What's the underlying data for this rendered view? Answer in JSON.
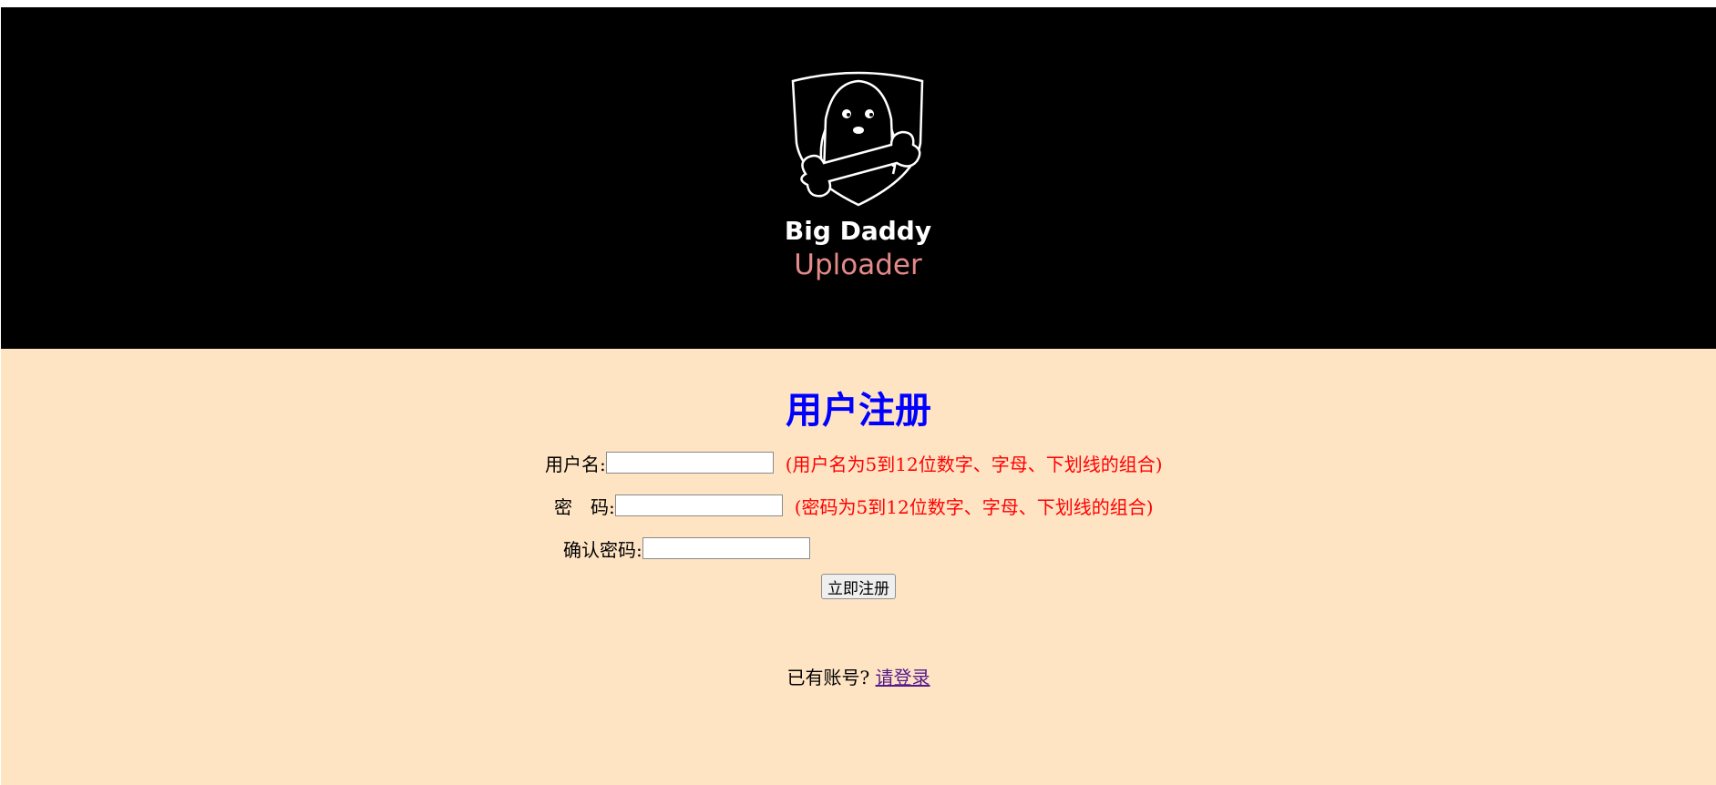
{
  "logo": {
    "line1": "Big Daddy",
    "line2": "Uploader",
    "icon": "dog-with-bone-shield-icon"
  },
  "form": {
    "title": "用户注册",
    "username": {
      "label": "用户名:",
      "value": "",
      "hint": "(用户名为5到12位数字、字母、下划线的组合)"
    },
    "password": {
      "label": "密　码:",
      "value": "",
      "hint": "(密码为5到12位数字、字母、下划线的组合)"
    },
    "confirm": {
      "label": "确认密码:",
      "value": ""
    },
    "submit_label": "立即注册"
  },
  "footer": {
    "prompt": "已有账号?",
    "link_label": "请登录"
  },
  "colors": {
    "banner_bg": "#000000",
    "page_bg": "#ffe4c4",
    "title": "#0000ff",
    "hint": "#ff0000",
    "link": "#551a8b",
    "logo_accent": "#e58a8a"
  }
}
